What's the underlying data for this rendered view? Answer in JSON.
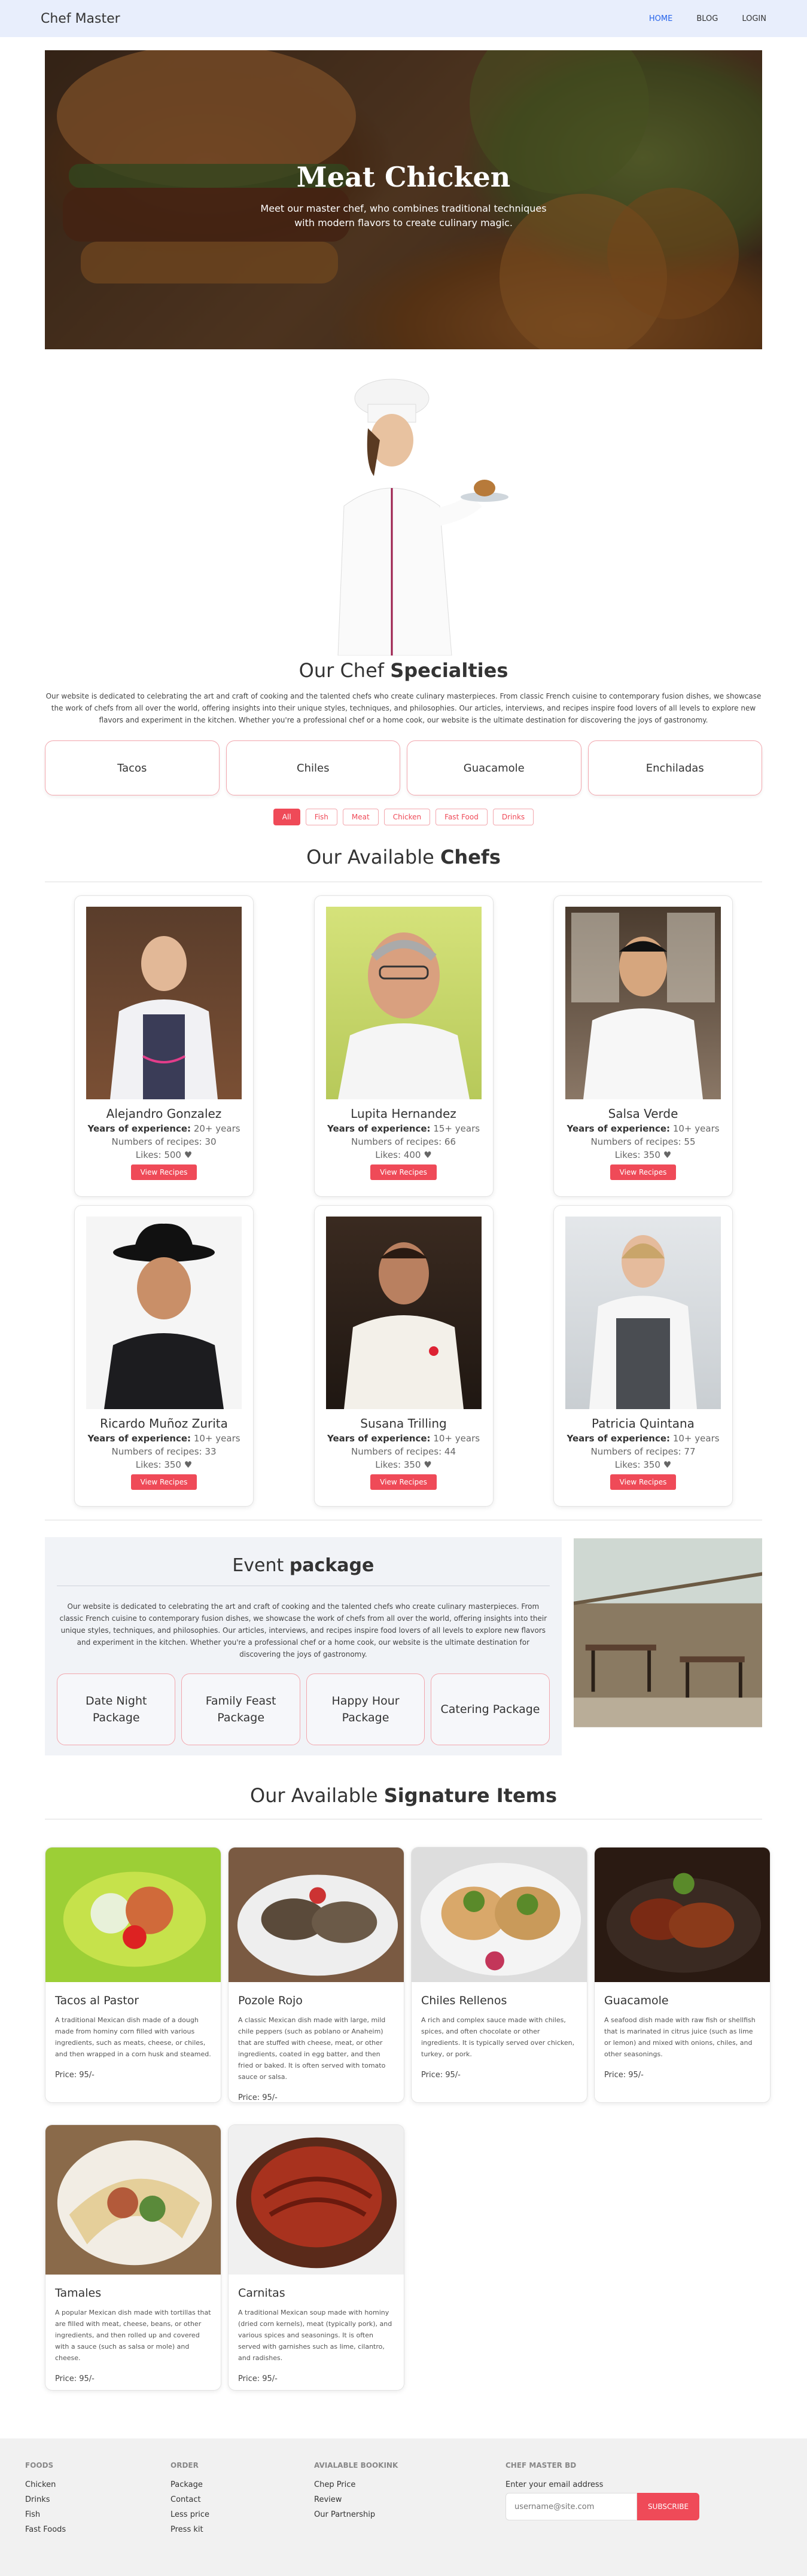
{
  "nav": {
    "brand": "Chef Master",
    "items": [
      "HOME",
      "BLOG",
      "LOGIN"
    ]
  },
  "hero": {
    "title": "Meat Chicken",
    "line1": "Meet our master chef, who combines traditional techniques",
    "line2": "with modern flavors to create culinary magic."
  },
  "about": {
    "title_a": "Our Chef ",
    "title_b": "Specialties",
    "text": "Our website is dedicated to celebrating the art and craft of cooking and the talented chefs who create culinary masterpieces. From classic French cuisine to contemporary fusion dishes, we showcase the work of chefs from all over the world, offering insights into their unique styles, techniques, and philosophies. Our articles, interviews, and recipes inspire food lovers of all levels to explore new flavors and experiment in the kitchen. Whether you're a professional chef or a home cook, our website is the ultimate destination for discovering the joys of gastronomy."
  },
  "categories": [
    "Tacos",
    "Chiles",
    "Guacamole",
    "Enchiladas"
  ],
  "filters": [
    "All",
    "Fish",
    "Meat",
    "Chicken",
    "Fast Food",
    "Drinks"
  ],
  "chefs_section": {
    "title_a": "Our Available ",
    "title_b": "Chefs"
  },
  "labels": {
    "exp": "Years of experience:",
    "rec": "Numbers of recipes:",
    "likes": "Likes:",
    "heart": "♥",
    "view": "View Recipes"
  },
  "chefs": [
    {
      "name": "Alejandro Gonzalez",
      "exp": "20+ years",
      "recipes": "30",
      "likes": "500"
    },
    {
      "name": "Lupita Hernandez",
      "exp": "15+ years",
      "recipes": "66",
      "likes": "400"
    },
    {
      "name": "Salsa Verde",
      "exp": "10+ years",
      "recipes": "55",
      "likes": "350"
    },
    {
      "name": "Ricardo Muñoz Zurita",
      "exp": "10+ years",
      "recipes": "33",
      "likes": "350"
    },
    {
      "name": "Susana Trilling",
      "exp": "10+ years",
      "recipes": "44",
      "likes": "350"
    },
    {
      "name": "Patricia Quintana",
      "exp": "10+ years",
      "recipes": "77",
      "likes": "350"
    }
  ],
  "event": {
    "title_a": "Event ",
    "title_b": "package",
    "text": "Our website is dedicated to celebrating the art and craft of cooking and the talented chefs who create culinary masterpieces. From classic French cuisine to contemporary fusion dishes, we showcase the work of chefs from all over the world, offering insights into their unique styles, techniques, and philosophies. Our articles, interviews, and recipes inspire food lovers of all levels to explore new flavors and experiment in the kitchen. Whether you're a professional chef or a home cook, our website is the ultimate destination for discovering the joys of gastronomy.",
    "packages": [
      "Date Night Package",
      "Family Feast Package",
      "Happy Hour Package",
      "Catering Package"
    ]
  },
  "signature": {
    "title_a": "Our Available ",
    "title_b": "Signature Items"
  },
  "items": [
    {
      "name": "Tacos al Pastor",
      "desc": "A traditional Mexican dish made of a dough made from hominy corn filled with various ingredients, such as meats, cheese, or chiles, and then wrapped in a corn husk and steamed.",
      "price": "Price: 95/-"
    },
    {
      "name": "Pozole Rojo",
      "desc": "A classic Mexican dish made with large, mild chile peppers (such as poblano or Anaheim) that are stuffed with cheese, meat, or other ingredients, coated in egg batter, and then fried or baked. It is often served with tomato sauce or salsa.",
      "price": "Price: 95/-"
    },
    {
      "name": "Chiles Rellenos",
      "desc": "A rich and complex sauce made with chiles, spices, and often chocolate or other ingredients. It is typically served over chicken, turkey, or pork.",
      "price": "Price: 95/-"
    },
    {
      "name": "Guacamole",
      "desc": "A seafood dish made with raw fish or shellfish that is marinated in citrus juice (such as lime or lemon) and mixed with onions, chiles, and other seasonings.",
      "price": "Price: 95/-"
    },
    {
      "name": "Tamales",
      "desc": "A popular Mexican dish made with tortillas that are filled with meat, cheese, beans, or other ingredients, and then rolled up and covered with a sauce (such as salsa or mole) and cheese.",
      "price": "Price: 95/-"
    },
    {
      "name": "Carnitas",
      "desc": "A traditional Mexican soup made with hominy (dried corn kernels), meat (typically pork), and various spices and seasonings. It is often served with garnishes such as lime, cilantro, and radishes.",
      "price": "Price: 95/-"
    }
  ],
  "footer": {
    "foods": {
      "title": "FOODS",
      "links": [
        "Chicken",
        "Drinks",
        "Fish",
        "Fast Foods"
      ]
    },
    "order": {
      "title": "ORDER",
      "links": [
        "Package",
        "Contact",
        "Less price",
        "Press kit"
      ]
    },
    "booking": {
      "title": "AVIALABLE BOOKINK",
      "links": [
        "Chep Price",
        "Review",
        "Our Partnership"
      ]
    },
    "newsletter": {
      "title": "CHEF MASTER BD",
      "label": "Enter your email address",
      "placeholder": "username@site.com",
      "button": "SUBSCRIBE"
    }
  }
}
